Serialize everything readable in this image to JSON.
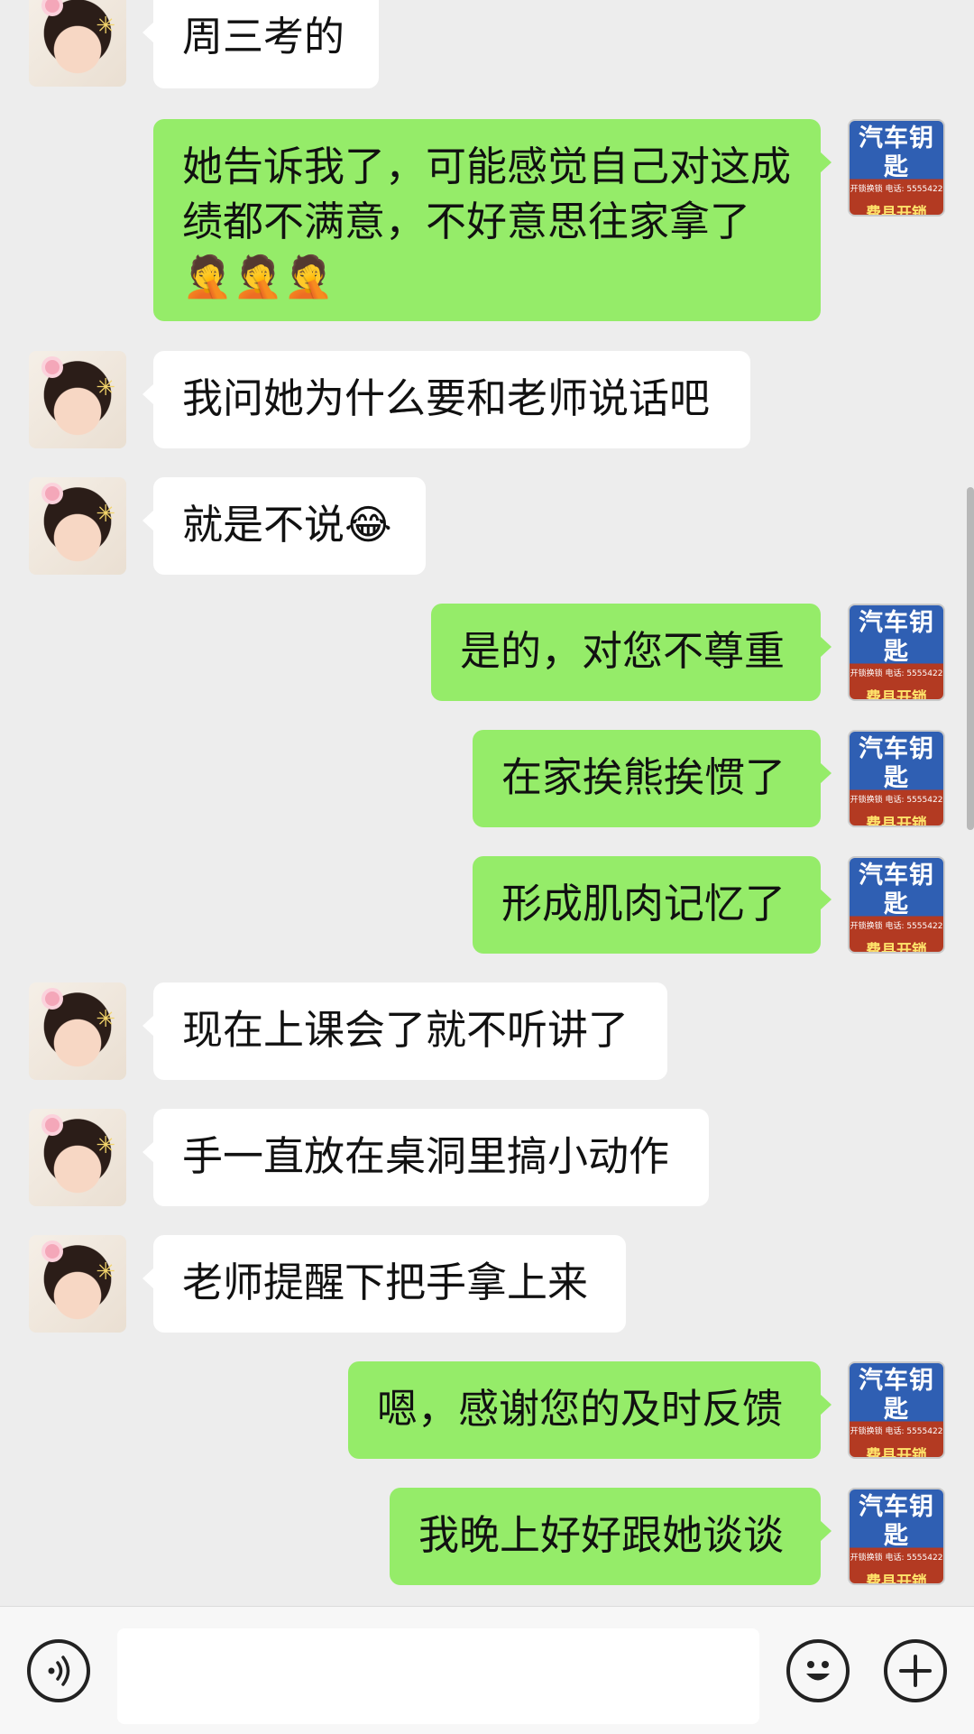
{
  "colors": {
    "background": "#ededed",
    "incoming_bubble": "#ffffff",
    "outgoing_bubble": "#95ec69",
    "input_bar": "#f7f7f7"
  },
  "contact_avatar": {
    "icon": "girl-photo-avatar"
  },
  "self_avatar": {
    "line1": "汽车钥匙",
    "line2": "开锁换锁 电话: 5555422",
    "line3": "费县开锁"
  },
  "messages": [
    {
      "side": "left",
      "text": "周三考的"
    },
    {
      "side": "right",
      "text": "她告诉我了，可能感觉自己对这成绩都不满意，不好意思往家拿了🤦🤦🤦"
    },
    {
      "side": "left",
      "text": "我问她为什么要和老师说话吧"
    },
    {
      "side": "left",
      "text": "就是不说😂"
    },
    {
      "side": "right",
      "text": "是的，对您不尊重"
    },
    {
      "side": "right",
      "text": "在家挨熊挨惯了"
    },
    {
      "side": "right",
      "text": "形成肌肉记忆了"
    },
    {
      "side": "left",
      "text": "现在上课会了就不听讲了"
    },
    {
      "side": "left",
      "text": "手一直放在桌洞里搞小动作"
    },
    {
      "side": "left",
      "text": "老师提醒下把手拿上来"
    },
    {
      "side": "right",
      "text": "嗯，感谢您的及时反馈"
    },
    {
      "side": "right",
      "text": "我晚上好好跟她谈谈"
    }
  ],
  "input_bar": {
    "voice_icon": "voice-icon",
    "emoji_icon": "emoji-icon",
    "plus_icon": "plus-icon",
    "placeholder": ""
  }
}
